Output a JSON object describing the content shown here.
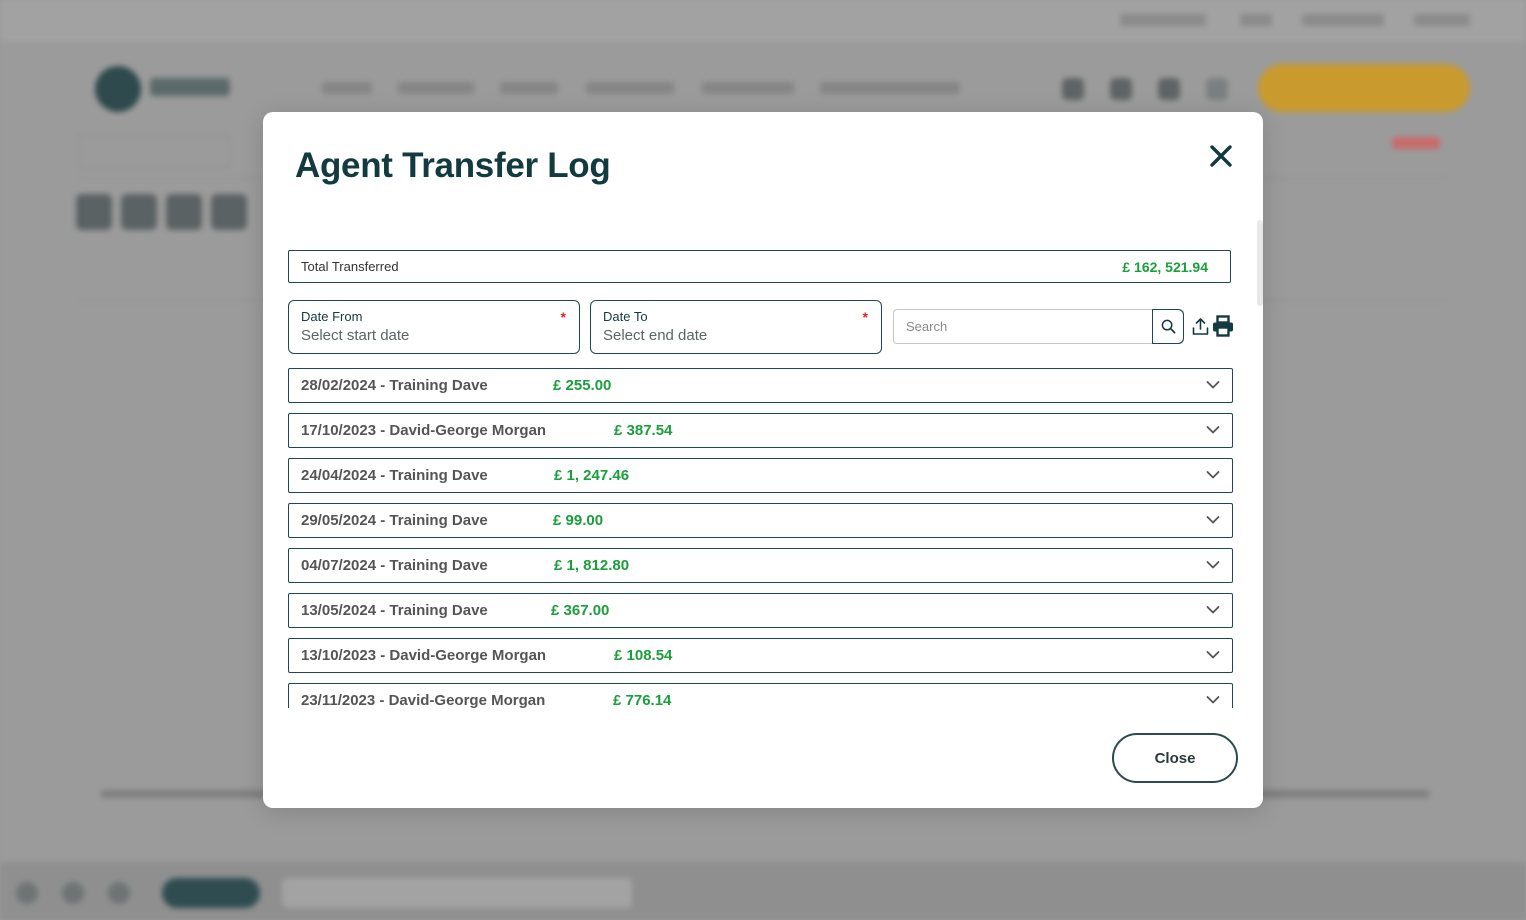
{
  "modal": {
    "title": "Agent Transfer Log",
    "total": {
      "label": "Total Transferred",
      "value": "£ 162, 521.94"
    },
    "date_from": {
      "label": "Date From",
      "placeholder": "Select start date",
      "required_mark": "*"
    },
    "date_to": {
      "label": "Date To",
      "placeholder": "Select end date",
      "required_mark": "*"
    },
    "search": {
      "placeholder": "Search",
      "value": ""
    },
    "icons": {
      "close": "close-icon",
      "search": "search-icon",
      "export": "upload-icon",
      "print": "printer-icon",
      "expand": "chevron-down-icon"
    },
    "colors": {
      "amount": "#1b9e3b",
      "border": "#1d4a4f",
      "title": "#123a3f",
      "required": "#d62828"
    },
    "entries": [
      {
        "title": "28/02/2024 - Training Dave",
        "amount": "£ 255.00"
      },
      {
        "title": "17/10/2023 - David-George Morgan",
        "amount": "£ 387.54"
      },
      {
        "title": "24/04/2024 - Training Dave",
        "amount": "£ 1, 247.46"
      },
      {
        "title": "29/05/2024 - Training Dave",
        "amount": "£ 99.00"
      },
      {
        "title": "04/07/2024 - Training Dave",
        "amount": "£ 1, 812.80"
      },
      {
        "title": "13/05/2024 - Training Dave",
        "amount": "£ 367.00"
      },
      {
        "title": "13/10/2023 - David-George Morgan",
        "amount": "£ 108.54"
      },
      {
        "title": "23/11/2023 - David-George Morgan",
        "amount": "£ 776.14"
      }
    ],
    "close_label": "Close"
  }
}
